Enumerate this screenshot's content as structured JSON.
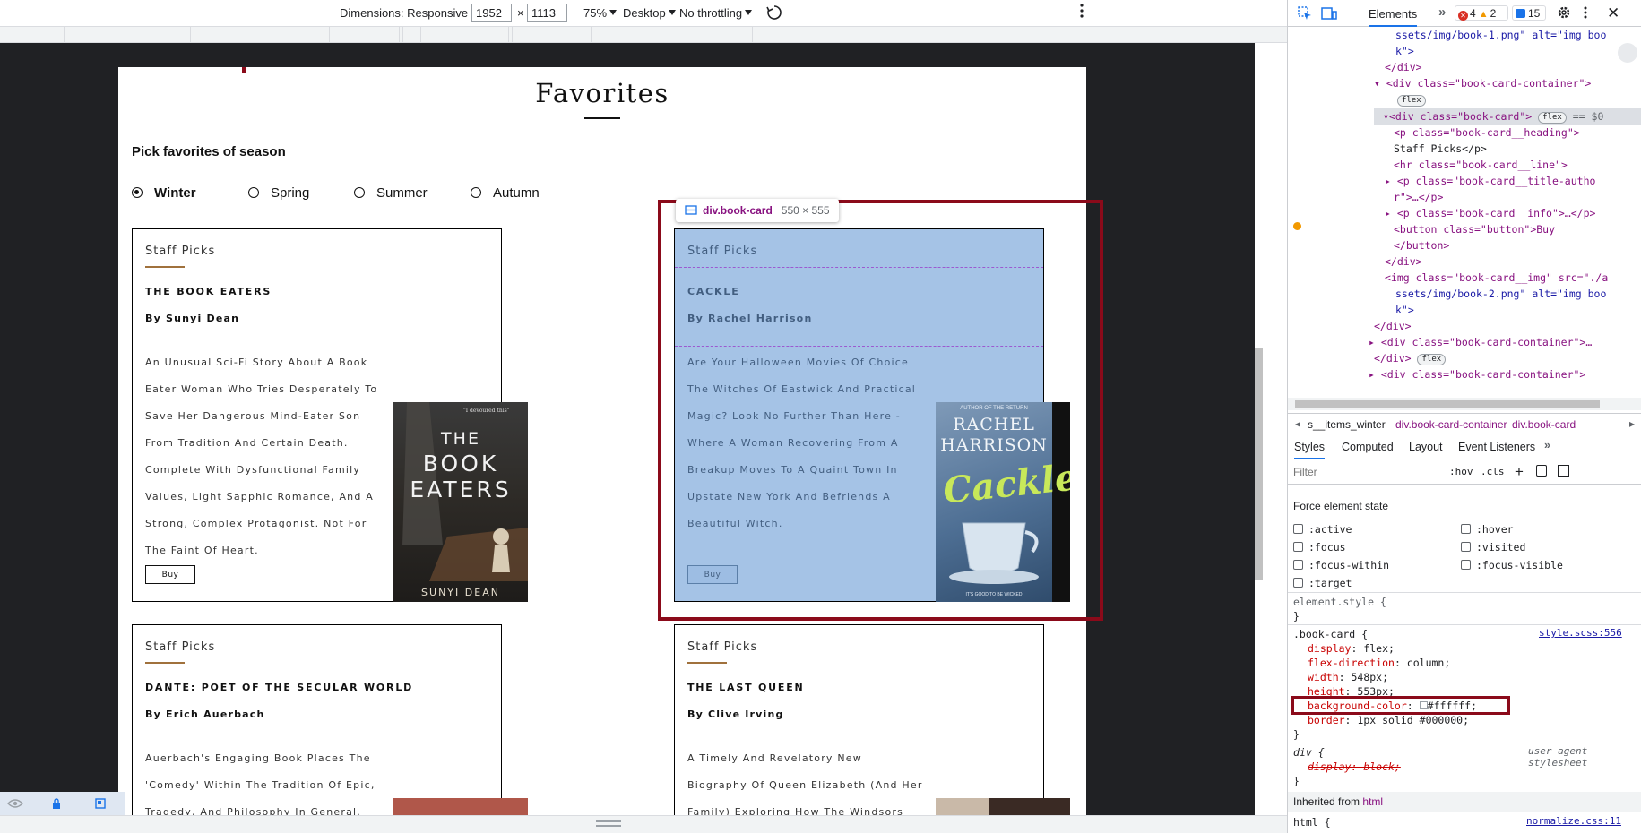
{
  "device_toolbar": {
    "dimensions_label": "Dimensions: Responsive",
    "width": "1952",
    "height": "1113",
    "times": "×",
    "zoom": "75%",
    "device": "Desktop",
    "throttle": "No throttling"
  },
  "page": {
    "title": "Favorites",
    "pick_label": "Pick favorites of season",
    "seasons": [
      "Winter",
      "Spring",
      "Summer",
      "Autumn"
    ],
    "selected_season": "Winter",
    "cards": [
      {
        "heading": "Staff Picks",
        "title": "THE BOOK EATERS",
        "author": "By Sunyi Dean",
        "desc": "An Unusual Sci-Fi Story About A Book Eater Woman Who Tries Desperately To Save Her Dangerous Mind-Eater Son From Tradition And Certain Death. Complete With Dysfunctional Family Values, Light Sapphic Romance, And A Strong, Complex Protagonist. Not For The Faint Of Heart.",
        "buy": "Buy",
        "cover": {
          "top": "\"I devoured this\"",
          "t1": "THE",
          "t2": "BOOK",
          "t3": "EATERS",
          "author": "SUNYI DEAN"
        }
      },
      {
        "heading": "Staff Picks",
        "title": "CACKLE",
        "author": "By Rachel Harrison",
        "desc": "Are Your Halloween Movies Of Choice The Witches Of Eastwick And Practical Magic? Look No Further Than Here - Where A Woman Recovering From A Breakup Moves To A Quaint Town In Upstate New York And Befriends A Beautiful Witch.",
        "buy": "Buy",
        "cover": {
          "top": "AUTHOR OF THE RETURN",
          "a1": "RACHEL",
          "a2": "HARRISON",
          "t": "Cackle",
          "bottom": "IT'S GOOD TO BE WICKED"
        }
      },
      {
        "heading": "Staff Picks",
        "title": "DANTE: POET OF THE SECULAR WORLD",
        "author": "By Erich Auerbach",
        "desc": "Auerbach's Engaging Book Places The 'Comedy' Within The Tradition Of Epic, Tragedy, And Philosophy In General."
      },
      {
        "heading": "Staff Picks",
        "title": "THE LAST QUEEN",
        "author": "By Clive Irving",
        "desc": "A Timely And Revelatory New Biography Of Queen Elizabeth (And Her Family) Exploring How The Windsors"
      }
    ]
  },
  "inspector": {
    "tooltip_selector": "div.book-card",
    "tooltip_size": "550 × 555"
  },
  "devtools": {
    "tabs": [
      "Elements"
    ],
    "errors": "4",
    "warnings": "2",
    "messages": "15",
    "dom_lines": [
      "ssets/img/book-1.png\" alt=\"img boo",
      "k\">",
      "</div>",
      "<div class=\"book-card-container\">",
      "flex",
      "<div class=\"book-card\">",
      "== $0",
      "<p class=\"book-card__heading\">",
      "Staff Picks</p>",
      "<hr class=\"book-card__line\">",
      "<p class=\"book-card__title-autho",
      "r\">…</p>",
      "<p class=\"book-card__info\">…</p>",
      "<button class=\"button\">Buy",
      "</button>",
      "</div>",
      "<img class=\"book-card__img\" src=\"./a",
      "ssets/img/book-2.png\" alt=\"img boo",
      "k\">",
      "</div>",
      "<div class=\"book-card-container\">…",
      "</div>",
      "<div class=\"book-card-container\">"
    ],
    "breadcrumbs": [
      "s__items_winter",
      "div.book-card-container",
      "div.book-card"
    ],
    "style_tabs": [
      "Styles",
      "Computed",
      "Layout",
      "Event Listeners"
    ],
    "filter_placeholder": "Filter",
    "hov": ":hov",
    ".cls": ".cls",
    "force_state_title": "Force element state",
    "states_left": [
      ":active",
      ":focus",
      ":focus-within",
      ":target"
    ],
    "states_right": [
      ":hover",
      ":visited",
      ":focus-visible"
    ],
    "element_style": "element.style {",
    "close_brace": "}",
    "rule_selector": ".book-card {",
    "rule_source": "style.scss:556",
    "props": [
      {
        "name": "display",
        "value": "flex;"
      },
      {
        "name": "flex-direction",
        "value": "column;"
      },
      {
        "name": "width",
        "value": "548px;"
      },
      {
        "name": "height",
        "value": "553px;"
      },
      {
        "name": "background-color",
        "value": "#ffffff;"
      },
      {
        "name": "border",
        "value": "1px solid #000000;"
      }
    ],
    "ua_selector": "div {",
    "ua_label": "user agent stylesheet",
    "ua_prop": "display: block;",
    "inherited": "Inherited from",
    "inherited_tag": "html",
    "html_rule": "html {",
    "normalize": "normalize.css:11"
  },
  "colors": {
    "highlight": "#8b0a1a",
    "selected_card": "#a5c3e6",
    "accent_line": "#a0713c"
  }
}
